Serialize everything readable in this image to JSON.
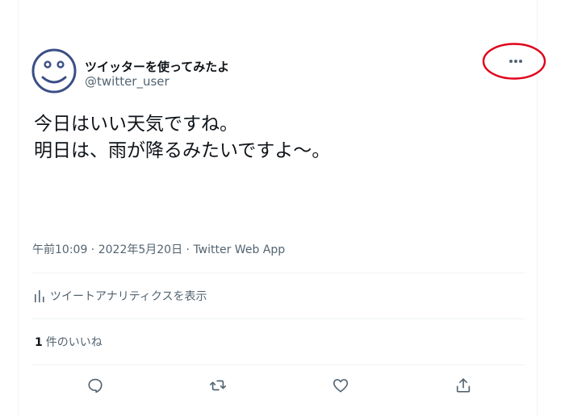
{
  "tweet": {
    "display_name": "ツイッターを使ってみたよ",
    "handle": "@twitter_user",
    "text_lines": [
      "今日はいい天気ですね。",
      "明日は、雨が降るみたいですよ〜。"
    ],
    "time": "午前10:09",
    "date": "2022年5月20日",
    "source": "Twitter Web App",
    "separator": " · "
  },
  "analytics": {
    "label": "ツイートアナリティクスを表示"
  },
  "likes": {
    "count": "1",
    "label": "件のいいね"
  },
  "actions": {
    "reply_icon": "reply-icon",
    "retweet_icon": "retweet-icon",
    "like_icon": "heart-icon",
    "share_icon": "share-icon"
  },
  "more_icon": "more-dots-icon",
  "annotation_color": "#e0001a",
  "colors": {
    "text": "#0f1419",
    "secondary": "#536471",
    "avatar": "#3b4f86",
    "border": "#eff3f4"
  }
}
